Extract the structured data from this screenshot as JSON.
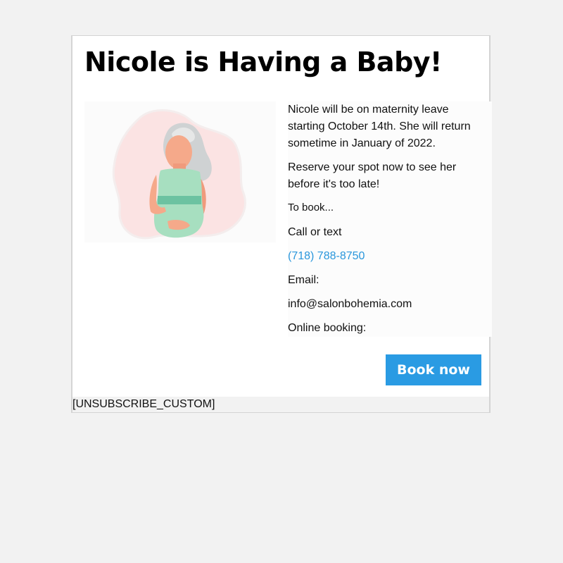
{
  "email": {
    "title": "Nicole is Having a Baby!",
    "illustration_alt": "",
    "paragraphs": {
      "leave": "Nicole will be on maternity leave starting October 14th. She will return sometime in January of 2022.",
      "reserve": "Reserve your spot now to see her before it's too late!",
      "to_book": "To book...",
      "call": "Call or text",
      "phone": "(718) 788-8750",
      "email_label": "Email:",
      "email_value": "info@salonbohemia.com",
      "online_label": "Online booking:"
    },
    "button_label": "Book now",
    "footer": "[UNSUBSCRIBE_CUSTOM]"
  },
  "colors": {
    "accent": "#2a9be3",
    "link": "#2a97dc",
    "background": "#f2f2f2"
  }
}
